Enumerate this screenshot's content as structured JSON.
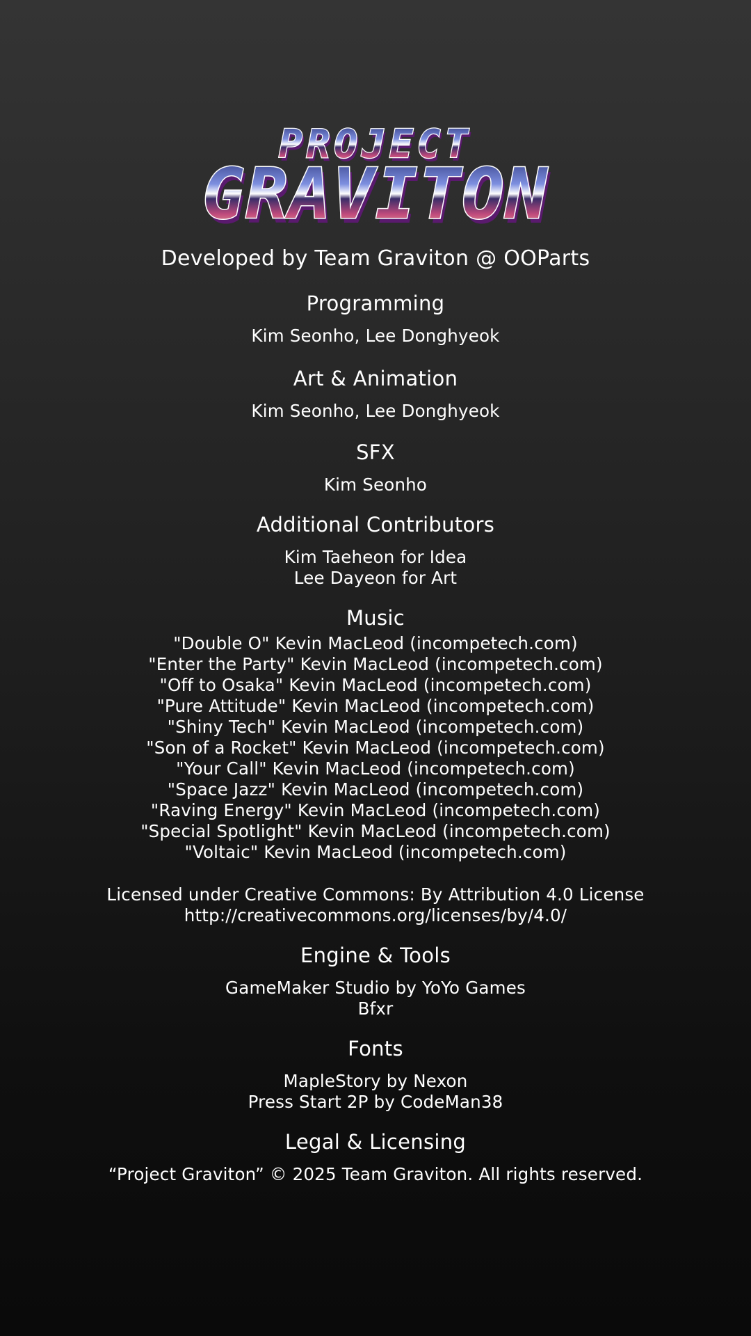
{
  "title": {
    "line1": "PROJECT",
    "line2": "GRAVITON"
  },
  "developer": "Developed by Team Graviton @ OOParts",
  "sections": {
    "programming": {
      "title": "Programming",
      "lines": [
        "Kim Seonho, Lee Donghyeok"
      ]
    },
    "art": {
      "title": "Art & Animation",
      "lines": [
        "Kim Seonho, Lee Donghyeok"
      ]
    },
    "sfx": {
      "title": "SFX",
      "lines": [
        "Kim Seonho"
      ]
    },
    "contributors": {
      "title": "Additional Contributors",
      "lines": [
        "Kim Taeheon for Idea",
        "Lee Dayeon for Art"
      ]
    },
    "music": {
      "title": "Music",
      "tracks": [
        "\"Double O\" Kevin MacLeod (incompetech.com)",
        "\"Enter the Party\" Kevin MacLeod (incompetech.com)",
        "\"Off to Osaka\" Kevin MacLeod (incompetech.com)",
        "\"Pure Attitude\" Kevin MacLeod (incompetech.com)",
        "\"Shiny Tech\" Kevin MacLeod (incompetech.com)",
        "\"Son of a Rocket\" Kevin MacLeod (incompetech.com)",
        "\"Your Call\" Kevin MacLeod (incompetech.com)",
        "\"Space Jazz\" Kevin MacLeod (incompetech.com)",
        "\"Raving Energy\" Kevin MacLeod (incompetech.com)",
        "\"Special Spotlight\" Kevin MacLeod (incompetech.com)",
        "\"Voltaic\" Kevin MacLeod (incompetech.com)"
      ],
      "license": [
        "Licensed under Creative Commons: By Attribution 4.0 License",
        "http://creativecommons.org/licenses/by/4.0/"
      ]
    },
    "engine": {
      "title": "Engine & Tools",
      "lines": [
        "GameMaker Studio by YoYo Games",
        "Bfxr"
      ]
    },
    "fonts": {
      "title": "Fonts",
      "lines": [
        "MapleStory by Nexon",
        "Press Start 2P by CodeMan38"
      ]
    },
    "legal": {
      "title": "Legal & Licensing",
      "lines": [
        "“Project Graviton” © 2025 Team Graviton. All rights reserved."
      ]
    }
  },
  "colors": {
    "text": "#ffffff",
    "logo_top": "#1e2a6e",
    "logo_mid": "#6a78c8",
    "logo_band": "#b0467a",
    "logo_bottom": "#f4a878",
    "logo_shadow": "#5a1a6e"
  }
}
